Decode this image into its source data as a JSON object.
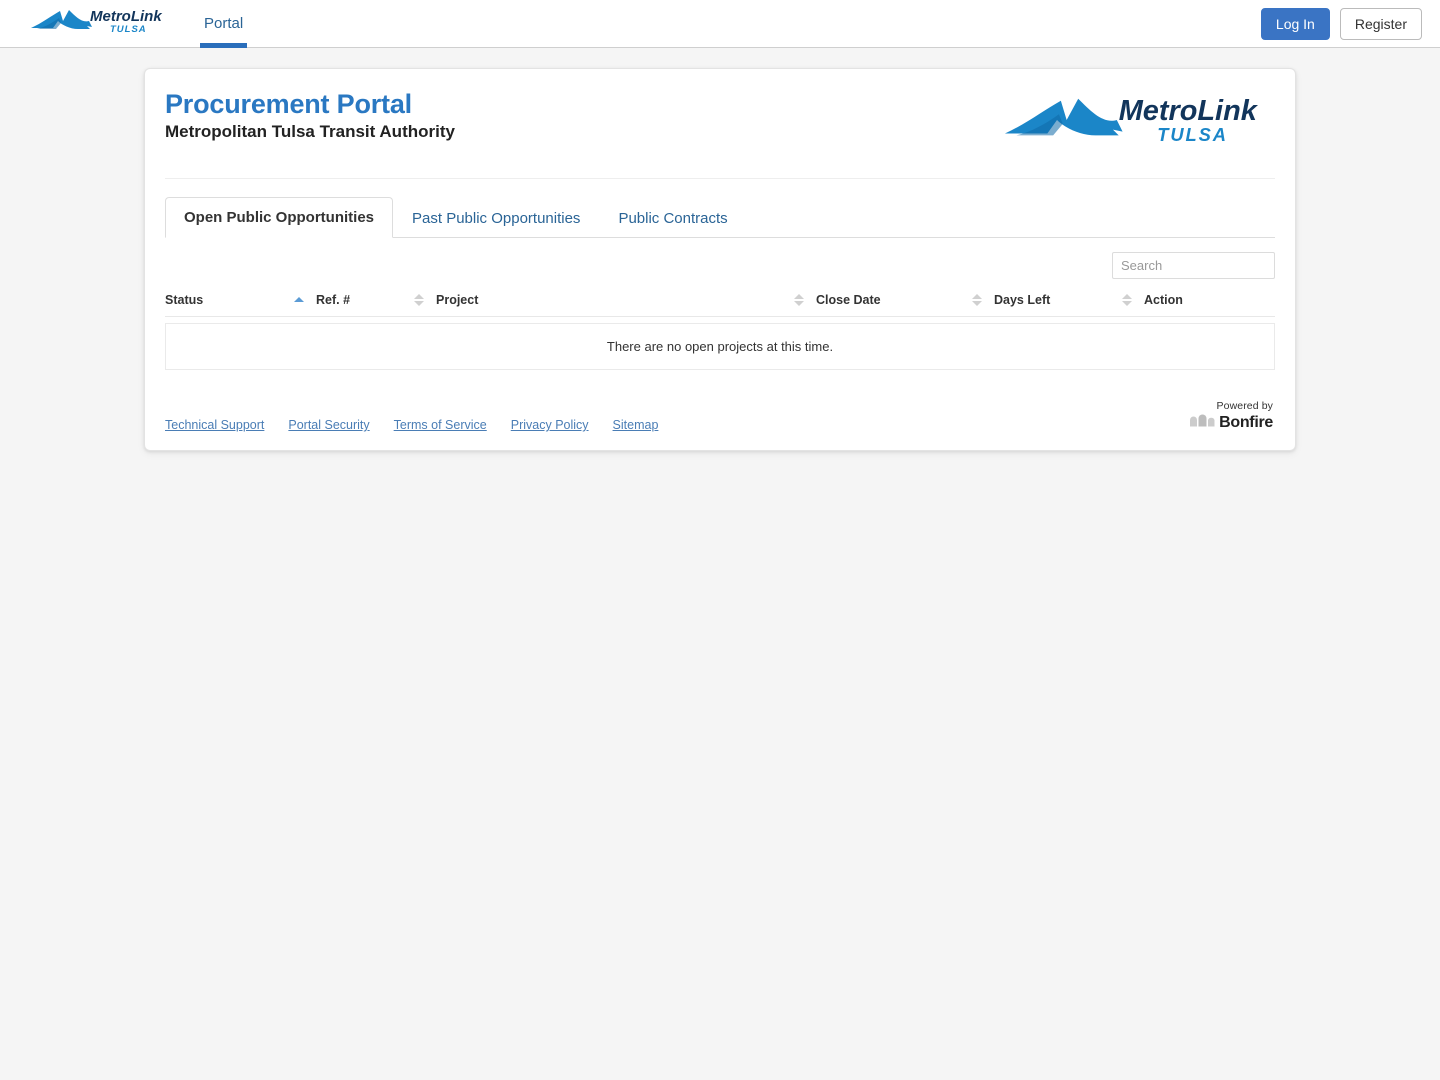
{
  "navbar": {
    "brand": {
      "icon": "metrolink-logo",
      "name": "MetroLink",
      "tagline": "TULSA"
    },
    "links": [
      {
        "label": "Portal",
        "active": true
      }
    ],
    "login_label": "Log In",
    "register_label": "Register"
  },
  "header": {
    "title": "Procurement Portal",
    "subtitle": "Metropolitan Tulsa Transit Authority",
    "logo": {
      "icon": "metrolink-logo",
      "name": "MetroLink",
      "tagline": "TULSA"
    }
  },
  "tabs": [
    {
      "label": "Open Public Opportunities",
      "active": true
    },
    {
      "label": "Past Public Opportunities",
      "active": false
    },
    {
      "label": "Public Contracts",
      "active": false
    }
  ],
  "search": {
    "value": "",
    "placeholder": "Search"
  },
  "table": {
    "columns": [
      {
        "label": "Status",
        "sort": "asc"
      },
      {
        "label": "Ref. #",
        "sort": "none"
      },
      {
        "label": "Project",
        "sort": "none"
      },
      {
        "label": "Close Date",
        "sort": "none"
      },
      {
        "label": "Days Left",
        "sort": "none"
      },
      {
        "label": "Action",
        "sort": "none"
      }
    ],
    "rows": [],
    "empty_message": "There are no open projects at this time."
  },
  "footer": {
    "links": [
      {
        "label": "Technical Support"
      },
      {
        "label": "Portal Security"
      },
      {
        "label": "Terms of Service"
      },
      {
        "label": "Privacy Policy"
      },
      {
        "label": "Sitemap"
      }
    ],
    "powered_by_label": "Powered by",
    "powered_by_brand": "Bonfire",
    "powered_by_icon": "bonfire-arches-icon"
  },
  "colors": {
    "accent_blue": "#2a78c2",
    "link_blue": "#2a6496",
    "primary_button": "#3a74c4",
    "logo_navy": "#12355b",
    "logo_blue": "#1b86c8",
    "page_background": "#f5f5f5"
  }
}
